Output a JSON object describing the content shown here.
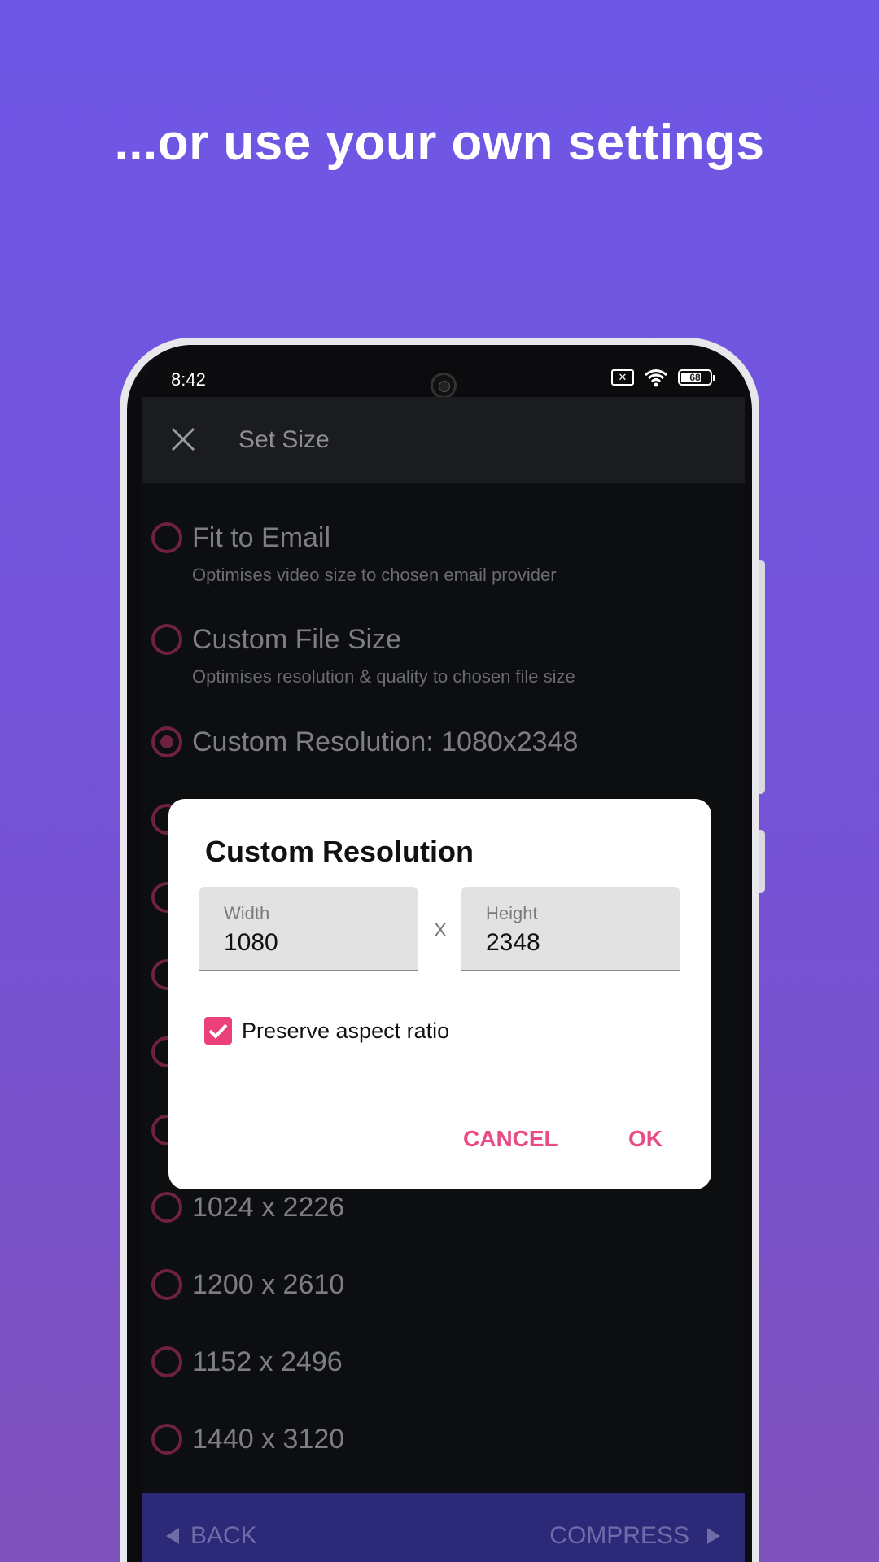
{
  "headline": "...or use your own settings",
  "status": {
    "time": "8:42",
    "battery": "68"
  },
  "appbar": {
    "title": "Set Size"
  },
  "options": [
    {
      "title": "Fit to Email",
      "subtitle": "Optimises video size to chosen email provider",
      "selected": false
    },
    {
      "title": "Custom File Size",
      "subtitle": "Optimises resolution & quality to chosen file size",
      "selected": false
    },
    {
      "title": "Custom Resolution: 1080x2348",
      "selected": true
    },
    {
      "title": "1024 x 2226",
      "selected": false
    },
    {
      "title": "1200 x 2610",
      "selected": false
    },
    {
      "title": "1152 x 2496",
      "selected": false
    },
    {
      "title": "1440 x 3120",
      "selected": false
    }
  ],
  "bottombar": {
    "back": "BACK",
    "compress": "COMPRESS"
  },
  "dialog": {
    "title": "Custom Resolution",
    "width_label": "Width",
    "width_value": "1080",
    "times": "X",
    "height_label": "Height",
    "height_value": "2348",
    "preserve_label": "Preserve aspect ratio",
    "preserve_checked": true,
    "cancel": "CANCEL",
    "ok": "OK"
  },
  "colors": {
    "accent": "#ec407a",
    "radio": "#6e2240",
    "background_top": "#6e57e6",
    "bottombar": "#2c2979"
  }
}
